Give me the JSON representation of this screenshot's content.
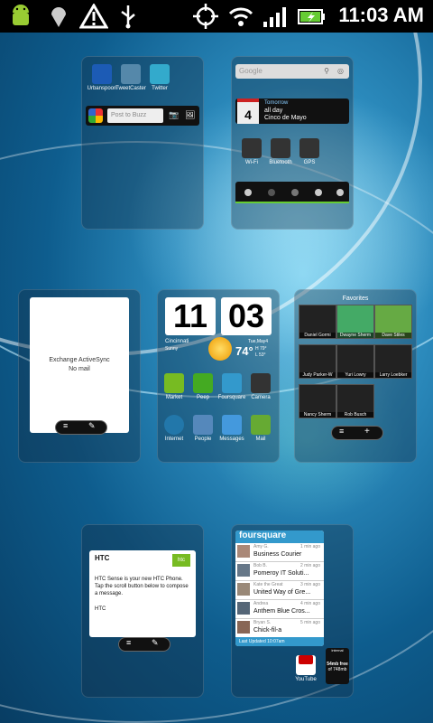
{
  "status_bar": {
    "time": "11:03 AM",
    "icons": [
      "android-icon",
      "map-pin-icon",
      "warning-icon",
      "usb-icon",
      "gps-icon",
      "wifi-icon",
      "signal-icon",
      "battery-charging-icon"
    ]
  },
  "social": {
    "apps": [
      "Urbanspoon",
      "TweetCaster",
      "Twitter"
    ],
    "buzz_placeholder": "Post to Buzz"
  },
  "search": {
    "placeholder": "Google"
  },
  "calendar": {
    "date_num": "4",
    "tomorrow_label": "Tomorrow",
    "all_day": "all day",
    "event": "Cinco de Mayo"
  },
  "toggles": [
    "Wi-Fi",
    "Bluetooth",
    "GPS"
  ],
  "mail": {
    "account": "Exchange ActiveSync",
    "status": "No mail"
  },
  "weather": {
    "hour": "11",
    "minute": "03",
    "city": "Cincinnati",
    "condition": "Sunny",
    "temp": "74°",
    "date": "Tue,May4",
    "hi": "H 79°",
    "lo": "L 53°"
  },
  "dock_apps": [
    "Market",
    "Peep",
    "Foursquare",
    "Camera",
    "Internet",
    "People",
    "Messages",
    "Mail"
  ],
  "favorites": {
    "title": "Favorites",
    "contacts": [
      "Daniel Gormi",
      "Dwayne Sherm",
      "Dave Stiles",
      "Judy Parker-W",
      "Yuri Lowry",
      "Larry Loebker",
      "Nancy Sherm",
      "Rob Busch"
    ]
  },
  "htc_msg": {
    "title": "HTC",
    "body": "HTC Sense is your new HTC Phone. Tap the scroll button below to compose a message.",
    "sig": "HTC"
  },
  "foursquare": {
    "logo": "foursquare",
    "checkins": [
      {
        "user": "Amy G.",
        "time": "1 min ago",
        "place": "Business Courier"
      },
      {
        "user": "Bob B.",
        "time": "2 min ago",
        "place": "Pomeroy IT Soluti..."
      },
      {
        "user": "Kate the Great",
        "time": "3 min ago",
        "place": "United Way of Gre..."
      },
      {
        "user": "Andrea",
        "time": "4 min ago",
        "place": "Anthem Blue Cros..."
      },
      {
        "user": "Bryan S.",
        "time": "5 min ago",
        "place": "Chick-fil-a"
      }
    ],
    "footer": "Last Updated 10:07am"
  },
  "bottom_apps": [
    "YouTube"
  ],
  "internal": {
    "label": "internal",
    "free": "54mb free",
    "of": "of 748mb"
  }
}
